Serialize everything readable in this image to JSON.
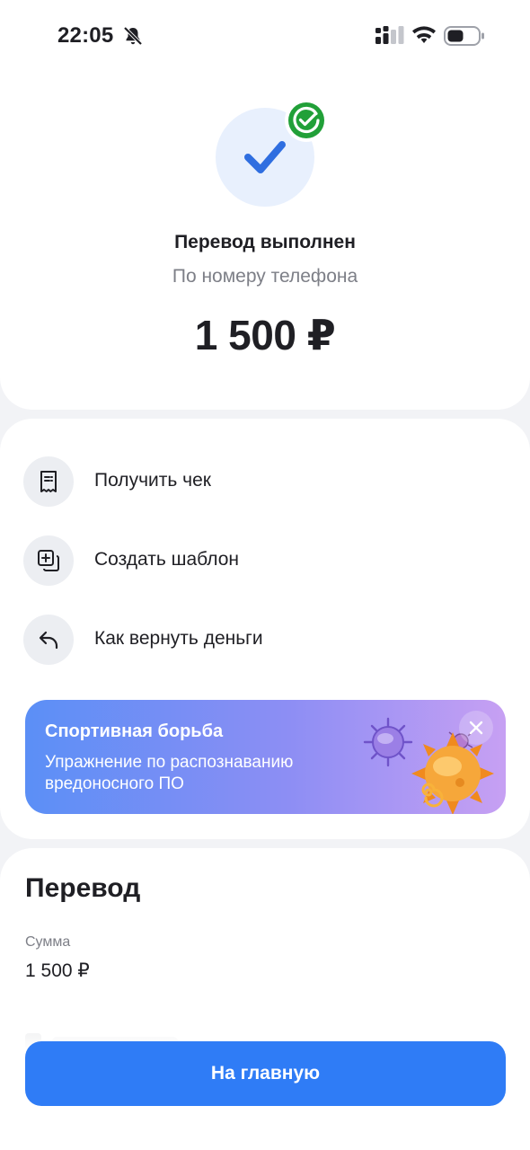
{
  "status_bar": {
    "time": "22:05"
  },
  "result": {
    "title": "Перевод выполнен",
    "subtitle": "По номеру телефона",
    "amount": "1 500 ₽"
  },
  "actions": [
    {
      "label": "Получить чек",
      "icon": "receipt-icon"
    },
    {
      "label": "Создать шаблон",
      "icon": "template-icon"
    },
    {
      "label": "Как вернуть деньги",
      "icon": "return-arrow-icon"
    }
  ],
  "promo": {
    "title": "Спортивная борьба",
    "text": "Упражнение по распознаванию вредоносного ПО",
    "close_icon": "close-icon"
  },
  "details": {
    "title": "Перевод",
    "amount_label": "Сумма",
    "amount_value": "1 500 ₽"
  },
  "home_button": {
    "label": "На главную"
  },
  "colors": {
    "accent": "#2f7cf6",
    "success": "#21a038",
    "background": "#f2f3f6"
  }
}
